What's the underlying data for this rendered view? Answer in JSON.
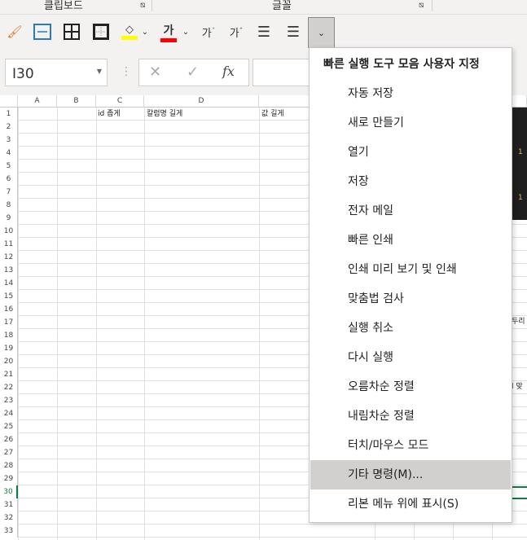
{
  "ribbon": {
    "groups": [
      "클립보드",
      "글꼴"
    ]
  },
  "toolbar": {
    "buttons": [
      "format-painter",
      "merge-center",
      "all-borders",
      "outside-borders",
      "fill-color",
      "font-color",
      "decrease-font",
      "increase-font",
      "align-left",
      "align-center",
      "customize-dropdown"
    ],
    "font_color_glyph": "가",
    "dec_glyph": "가",
    "inc_glyph": "가",
    "fill_color": "#ffff00",
    "font_color": "#ff0000"
  },
  "formula": {
    "name_box": "I30",
    "fx": "fx",
    "cancel": "✕",
    "enter": "✓"
  },
  "sheet": {
    "columns": [
      "A",
      "B",
      "C",
      "D"
    ],
    "row_count": 33,
    "cells": {
      "C1": "id 좁게",
      "D1": "칼럼명 길게",
      "E1": "값 길게"
    },
    "right_fragments": [
      "1",
      "1",
      "두리",
      "l 맞"
    ]
  },
  "menu": {
    "title": "빠른 실행 도구 모음 사용자 지정",
    "items": [
      "자동 저장",
      "새로 만들기",
      "열기",
      "저장",
      "전자 메일",
      "빠른 인쇄",
      "인쇄 미리 보기 및 인쇄",
      "맞춤법 검사",
      "실행 취소",
      "다시 실행",
      "오름차순 정렬",
      "내림차순 정렬",
      "터치/마우스 모드",
      "기타 명령(M)...",
      "리본 메뉴 위에 표시(S)"
    ],
    "highlighted": "기타 명령(M)..."
  }
}
